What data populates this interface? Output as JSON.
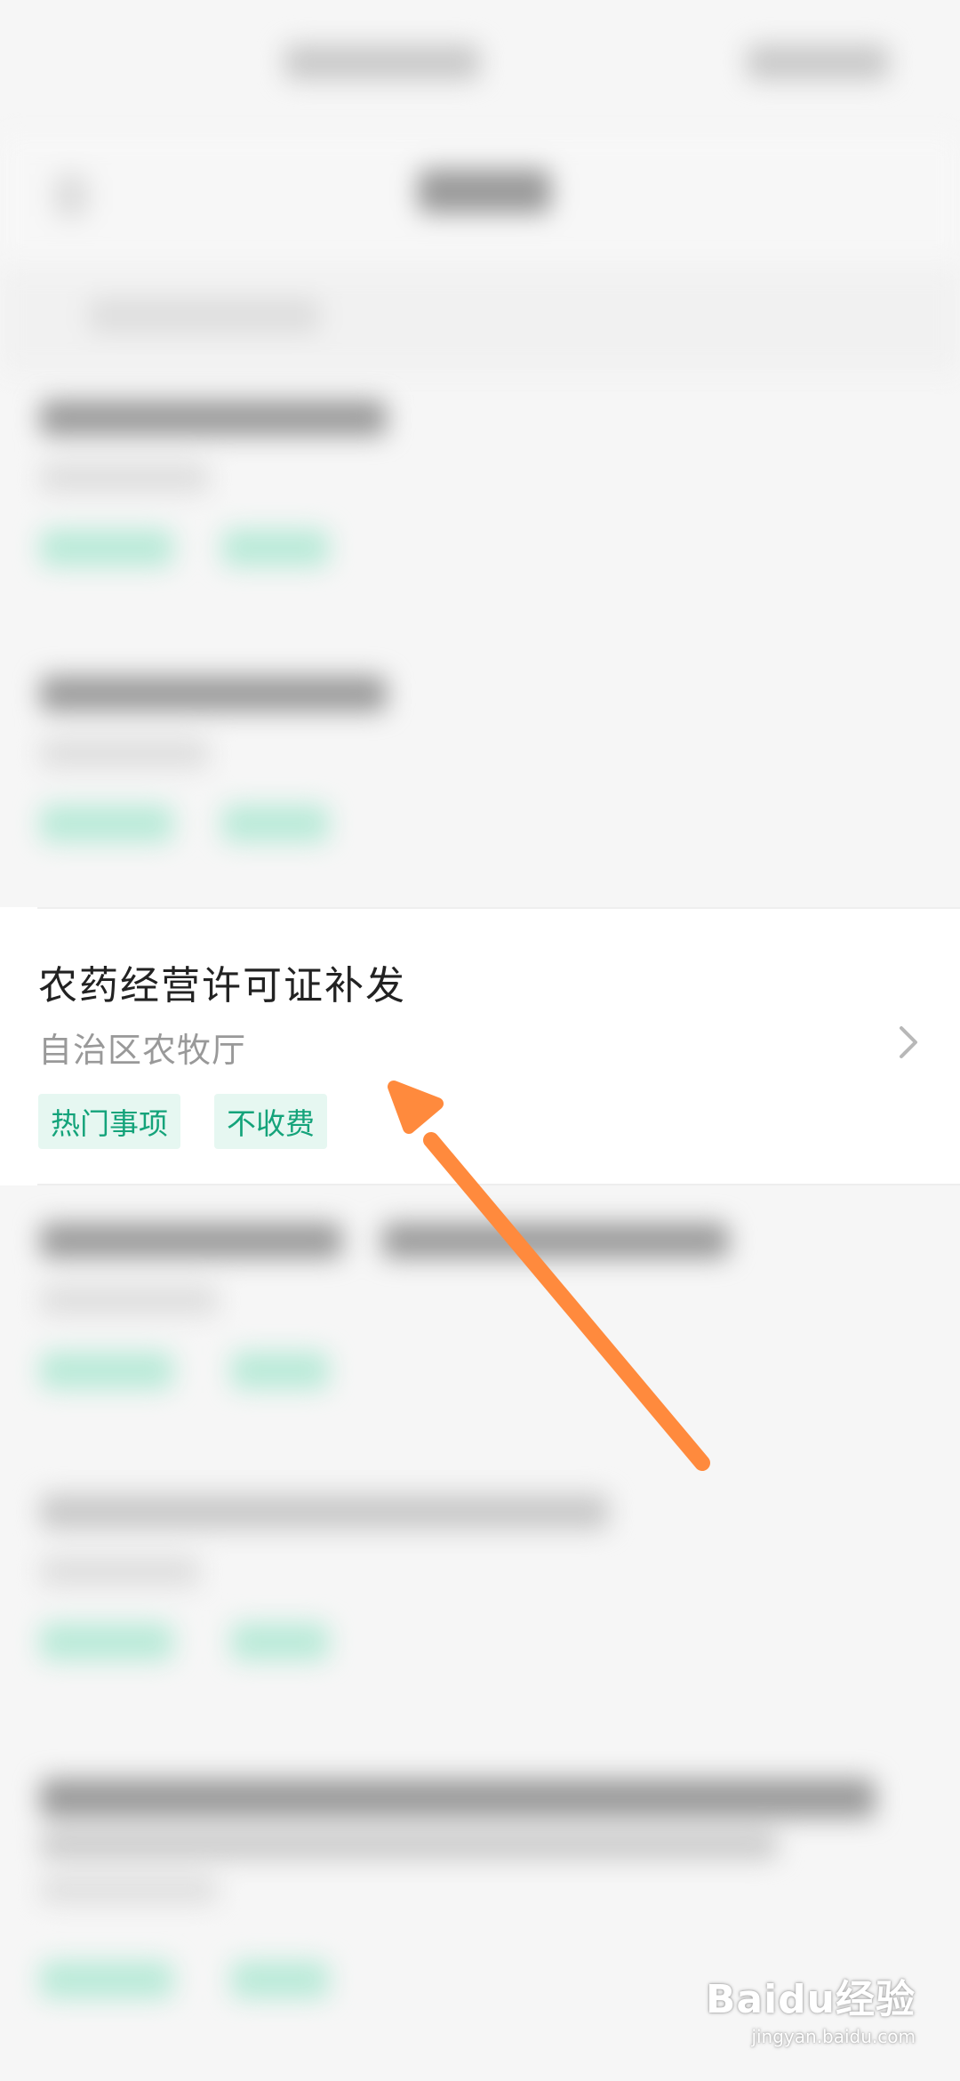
{
  "item": {
    "title": "农药经营许可证补发",
    "department": "自治区农牧厅",
    "tags": [
      "热门事项",
      "不收费"
    ]
  },
  "icons": {
    "chevron": "chevron-right-icon",
    "arrow": "orange-pointer-arrow"
  },
  "colors": {
    "arrow": "#ff8a3d",
    "tag_text": "#14a37a",
    "tag_bg": "#e6f7f1"
  },
  "watermark": {
    "brand": "Baidu经验",
    "url": "jingyan.baidu.com"
  }
}
